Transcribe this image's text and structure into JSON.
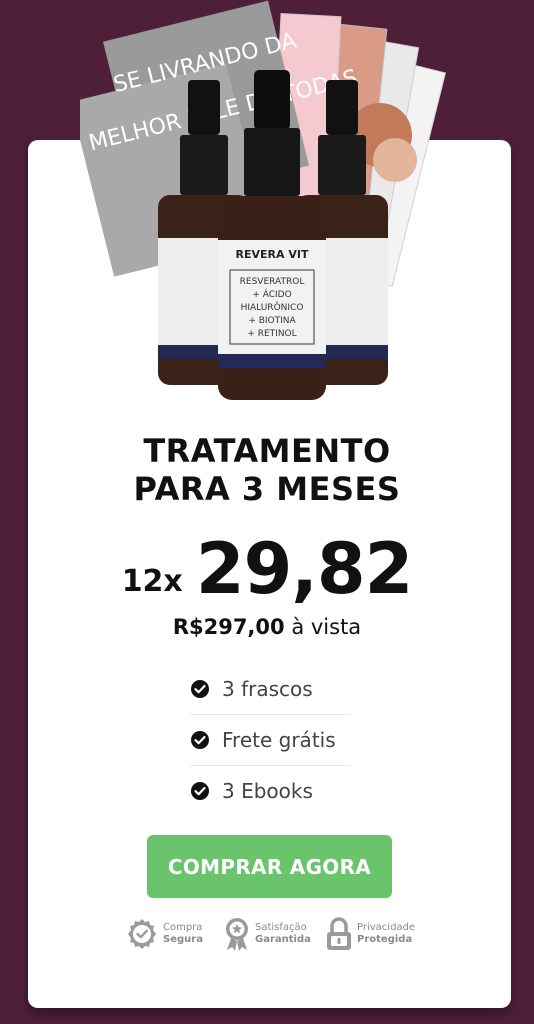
{
  "product": {
    "brand": "REVERA VIT",
    "label_lines": [
      "RESVERATROL",
      "+ ÁCIDO",
      "HIALURÔNICO",
      "+ BIOTINA",
      "+ RETINOL"
    ],
    "book_titles": [
      "SE LIVRANDO DA",
      "MELHOR PELE DE TODAS"
    ]
  },
  "offer": {
    "title_line1": "TRATAMENTO",
    "title_line2": "PARA 3 MESES",
    "installments_prefix": "12x",
    "installment_value": "29,82",
    "cash_price": "R$297,00",
    "cash_suffix": "à vista"
  },
  "features": [
    {
      "label": "3 frascos",
      "icon": "check-circle-icon"
    },
    {
      "label": "Frete grátis",
      "icon": "check-circle-icon"
    },
    {
      "label": "3 Ebooks",
      "icon": "check-circle-icon"
    }
  ],
  "cta": {
    "label": "COMPRAR AGORA",
    "color": "#69c46c"
  },
  "badges": [
    {
      "top": "Compra",
      "bottom": "Segura",
      "icon": "shield-check-icon"
    },
    {
      "top": "Satisfação",
      "bottom": "Garantida",
      "icon": "award-medal-icon"
    },
    {
      "top": "Privacidade",
      "bottom": "Protegida",
      "icon": "padlock-icon"
    }
  ],
  "colors": {
    "background": "#4f1f3a",
    "card": "#ffffff",
    "button": "#69c46c"
  }
}
